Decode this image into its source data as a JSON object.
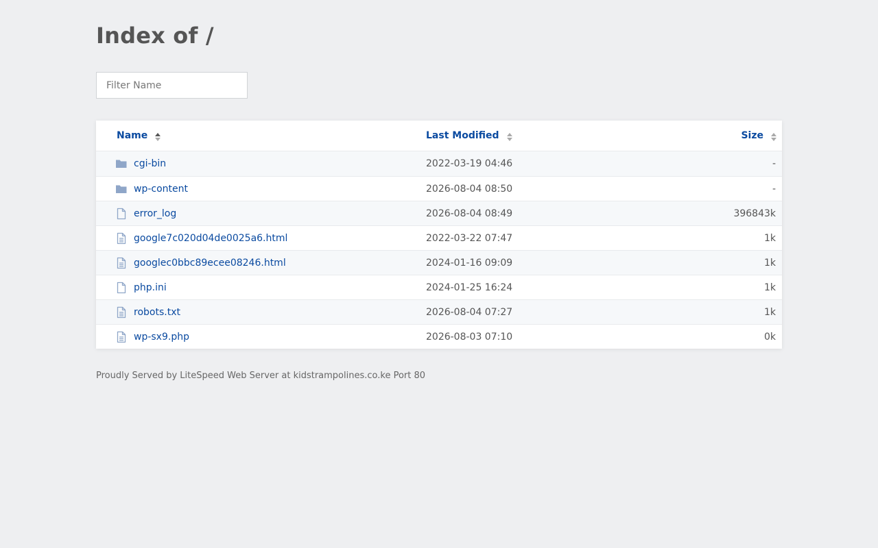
{
  "page": {
    "title": "Index of /",
    "filter_placeholder": "Filter Name"
  },
  "table": {
    "columns": {
      "name": "Name",
      "modified": "Last Modified",
      "size": "Size"
    },
    "rows": [
      {
        "name": "cgi-bin",
        "modified": "2022-03-19 04:46",
        "size": "-",
        "icon": "folder-icon"
      },
      {
        "name": "wp-content",
        "modified": "2026-08-04 08:50",
        "size": "-",
        "icon": "folder-icon"
      },
      {
        "name": "error_log",
        "modified": "2026-08-04 08:49",
        "size": "396843k",
        "icon": "file-icon"
      },
      {
        "name": "google7c020d04de0025a6.html",
        "modified": "2022-03-22 07:47",
        "size": "1k",
        "icon": "text-file-icon"
      },
      {
        "name": "googlec0bbc89ecee08246.html",
        "modified": "2024-01-16 09:09",
        "size": "1k",
        "icon": "text-file-icon"
      },
      {
        "name": "php.ini",
        "modified": "2024-01-25 16:24",
        "size": "1k",
        "icon": "file-icon"
      },
      {
        "name": "robots.txt",
        "modified": "2026-08-04 07:27",
        "size": "1k",
        "icon": "text-file-icon"
      },
      {
        "name": "wp-sx9.php",
        "modified": "2026-08-03 07:10",
        "size": "0k",
        "icon": "text-file-icon"
      }
    ]
  },
  "footer": {
    "text": "Proudly Served by LiteSpeed Web Server at kidstrampolines.co.ke Port 80"
  },
  "colors": {
    "link": "#0a4aa0",
    "folder_icon": "#8fa6c8",
    "file_icon": "#8fa6c8",
    "background": "#eeeff1"
  }
}
